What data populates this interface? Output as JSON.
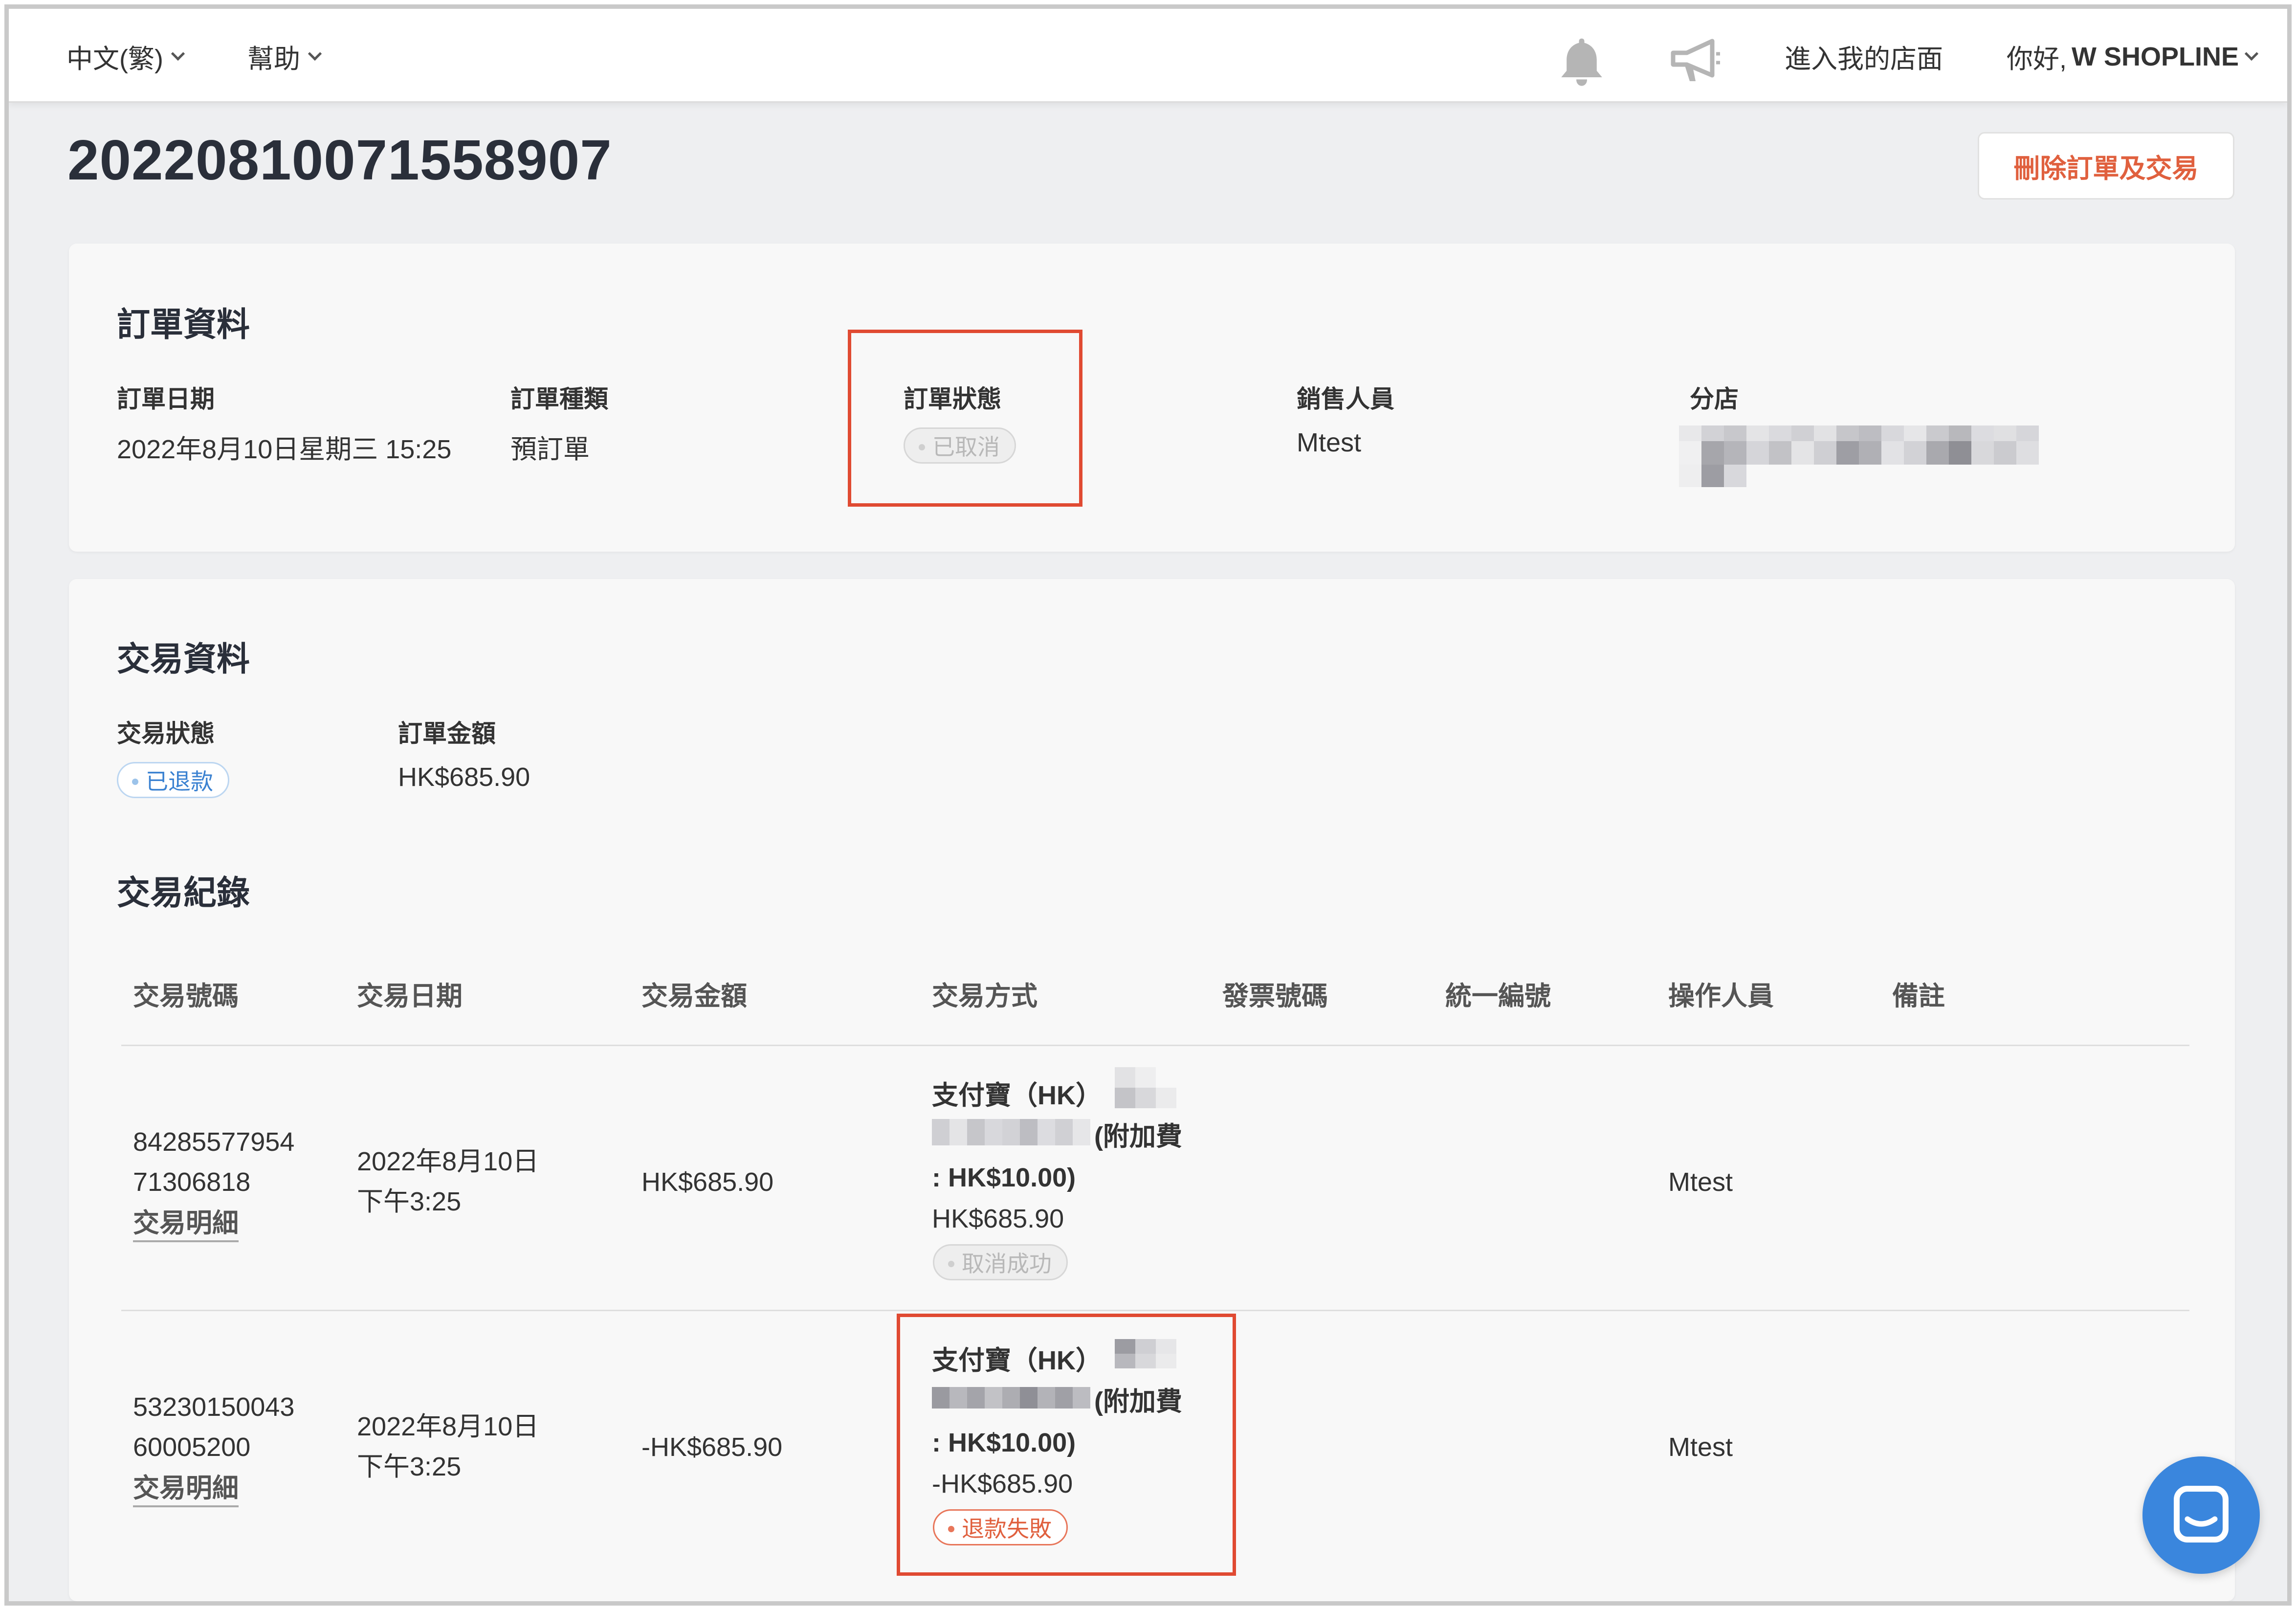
{
  "topbar": {
    "language": "中文(繁)",
    "help": "幫助",
    "store_link": "進入我的店面",
    "greeting": "你好,",
    "user_name": "W SHOPLINE"
  },
  "header": {
    "order_number": "20220810071558907",
    "delete_button": "刪除訂單及交易"
  },
  "order_info": {
    "title": "訂單資料",
    "date_label": "訂單日期",
    "date_value": "2022年8月10日星期三 15:25",
    "type_label": "訂單種類",
    "type_value": "預訂單",
    "status_label": "訂單狀態",
    "status_value": "已取消",
    "sales_label": "銷售人員",
    "sales_value": "Mtest",
    "branch_label": "分店"
  },
  "transaction_info": {
    "title": "交易資料",
    "status_label": "交易狀態",
    "status_value": "已退款",
    "amount_label": "訂單金額",
    "amount_value": "HK$685.90"
  },
  "transaction_log": {
    "title": "交易紀錄",
    "columns": [
      "交易號碼",
      "交易日期",
      "交易金額",
      "交易方式",
      "發票號碼",
      "統一編號",
      "操作人員",
      "備註"
    ],
    "rows": [
      {
        "txn_no_line1": "84285577954",
        "txn_no_line2": "71306818",
        "detail_link": "交易明細",
        "date_line1": "2022年8月10日",
        "date_line2": "下午3:25",
        "amount": "HK$685.90",
        "method_name": "支付寶（HK）",
        "method_fee_prefix": "(附加費",
        "method_fee": ": HK$10.00)",
        "method_amount": "HK$685.90",
        "method_status": "取消成功",
        "operator": "Mtest"
      },
      {
        "txn_no_line1": "53230150043",
        "txn_no_line2": "60005200",
        "detail_link": "交易明細",
        "date_line1": "2022年8月10日",
        "date_line2": "下午3:25",
        "amount": "-HK$685.90",
        "method_name": "支付寶（HK）",
        "method_fee_prefix": "(附加費",
        "method_fee": ": HK$10.00)",
        "method_amount": "-HK$685.90",
        "method_status": "退款失敗",
        "operator": "Mtest"
      }
    ]
  },
  "icons": {
    "bell": "bell-icon",
    "megaphone": "megaphone-icon",
    "chat": "chat-icon"
  },
  "colors": {
    "accent_red": "#e04a32",
    "link_blue": "#3b82d1",
    "chat_blue": "#3a86dd"
  }
}
